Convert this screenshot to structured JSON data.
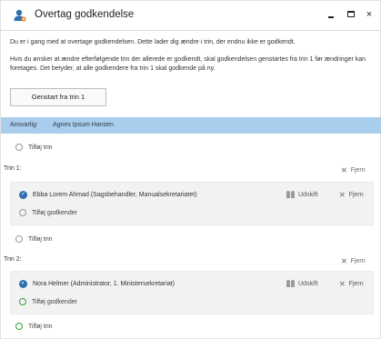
{
  "window": {
    "title": "Overtag godkendelse",
    "minimize_icon": "minimize-icon",
    "maximize_icon": "maximize-icon",
    "close_label": "×"
  },
  "intro": {
    "line1": "Du er i gang med at overtage godkendelsen. Dette lader dig ændre i trin, der endnu ikke er godkendt.",
    "line2": "Hvis du ønsker at ændre efterfølgende trin der allerede er godkendt, skal godkendelsen genstartes fra trin 1 før ændringer kan foretages. Det betyder, at alle godkendere fra trin 1 skal godkende på ny."
  },
  "restart_button": "Genstart fra trin 1",
  "responsible": {
    "label": "Ansvarlig:",
    "name": "Agnes Ipsum Hansen"
  },
  "add_step_label": "Tilføj trin",
  "steps": [
    {
      "label": "Trin 1:",
      "remove_label": "Fjern",
      "approver": "Ebba Lorem Ahmad (Sagsbehandler, Manualsekretariatet)",
      "approver_status": "approved",
      "replace_label": "Udskift",
      "approver_remove_label": "Fjern",
      "add_approver_label": "Tilføj godkender"
    },
    {
      "label": "Trin 2:",
      "remove_label": "Fjern",
      "approver": "Nora Helmer (Administrator, 1. Ministersekretariat)",
      "approver_status": "pending",
      "replace_label": "Udskift",
      "approver_remove_label": "Fjern",
      "add_approver_label": "Tilføj godkender"
    }
  ],
  "colors": {
    "accent": "#2f6fb2",
    "responsible_bar": "#a9cdec",
    "add_green": "#3a9d3a"
  }
}
